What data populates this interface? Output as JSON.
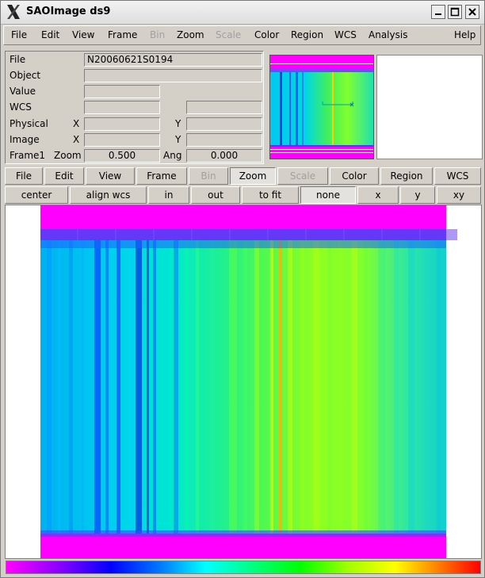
{
  "window": {
    "title": "SAOImage ds9",
    "minimize_icon": "minimize-icon",
    "maximize_icon": "maximize-icon",
    "close_icon": "close-icon"
  },
  "menubar": {
    "items": [
      {
        "label": "File",
        "enabled": true
      },
      {
        "label": "Edit",
        "enabled": true
      },
      {
        "label": "View",
        "enabled": true
      },
      {
        "label": "Frame",
        "enabled": true
      },
      {
        "label": "Bin",
        "enabled": false
      },
      {
        "label": "Zoom",
        "enabled": true
      },
      {
        "label": "Scale",
        "enabled": false
      },
      {
        "label": "Color",
        "enabled": true
      },
      {
        "label": "Region",
        "enabled": true
      },
      {
        "label": "WCS",
        "enabled": true
      },
      {
        "label": "Analysis",
        "enabled": true
      },
      {
        "label": "Help",
        "enabled": true
      }
    ]
  },
  "info": {
    "file_label": "File",
    "file_value": "N20060621S0194",
    "object_label": "Object",
    "object_value": "",
    "value_label": "Value",
    "value_value": "",
    "wcs_label": "WCS",
    "wcs_value": "",
    "wcs_value2": "",
    "physical_label": "Physical",
    "physical_x_label": "X",
    "physical_x": "",
    "physical_y_label": "Y",
    "physical_y": "",
    "image_label": "Image",
    "image_x_label": "X",
    "image_x": "",
    "image_y_label": "Y",
    "image_y": "",
    "frame_label": "Frame1",
    "zoom_label": "Zoom",
    "zoom_value": "0.500",
    "angle_label": "Ang",
    "angle_value": "0.000"
  },
  "buttonbar_main": [
    {
      "label": "File",
      "enabled": true,
      "selected": false
    },
    {
      "label": "Edit",
      "enabled": true,
      "selected": false
    },
    {
      "label": "View",
      "enabled": true,
      "selected": false
    },
    {
      "label": "Frame",
      "enabled": true,
      "selected": false
    },
    {
      "label": "Bin",
      "enabled": false,
      "selected": false
    },
    {
      "label": "Zoom",
      "enabled": true,
      "selected": true
    },
    {
      "label": "Scale",
      "enabled": false,
      "selected": false
    },
    {
      "label": "Color",
      "enabled": true,
      "selected": false
    },
    {
      "label": "Region",
      "enabled": true,
      "selected": false
    },
    {
      "label": "WCS",
      "enabled": true,
      "selected": false
    }
  ],
  "buttonbar_zoom": [
    {
      "label": "center",
      "selected": false
    },
    {
      "label": "align wcs",
      "selected": false
    },
    {
      "label": "in",
      "selected": false
    },
    {
      "label": "out",
      "selected": false
    },
    {
      "label": "to fit",
      "selected": false
    },
    {
      "label": "none",
      "selected": true
    },
    {
      "label": "x",
      "selected": false
    },
    {
      "label": "y",
      "selected": false
    },
    {
      "label": "xy",
      "selected": false
    }
  ],
  "colors": {
    "frame_border": "#ff00ff",
    "colormap": [
      "#ff00ff",
      "#8000ff",
      "#0000ff",
      "#00c0ff",
      "#00ffff",
      "#00ff80",
      "#00ff00",
      "#c0ff00",
      "#ffff00",
      "#ff8000",
      "#ff0000"
    ]
  }
}
